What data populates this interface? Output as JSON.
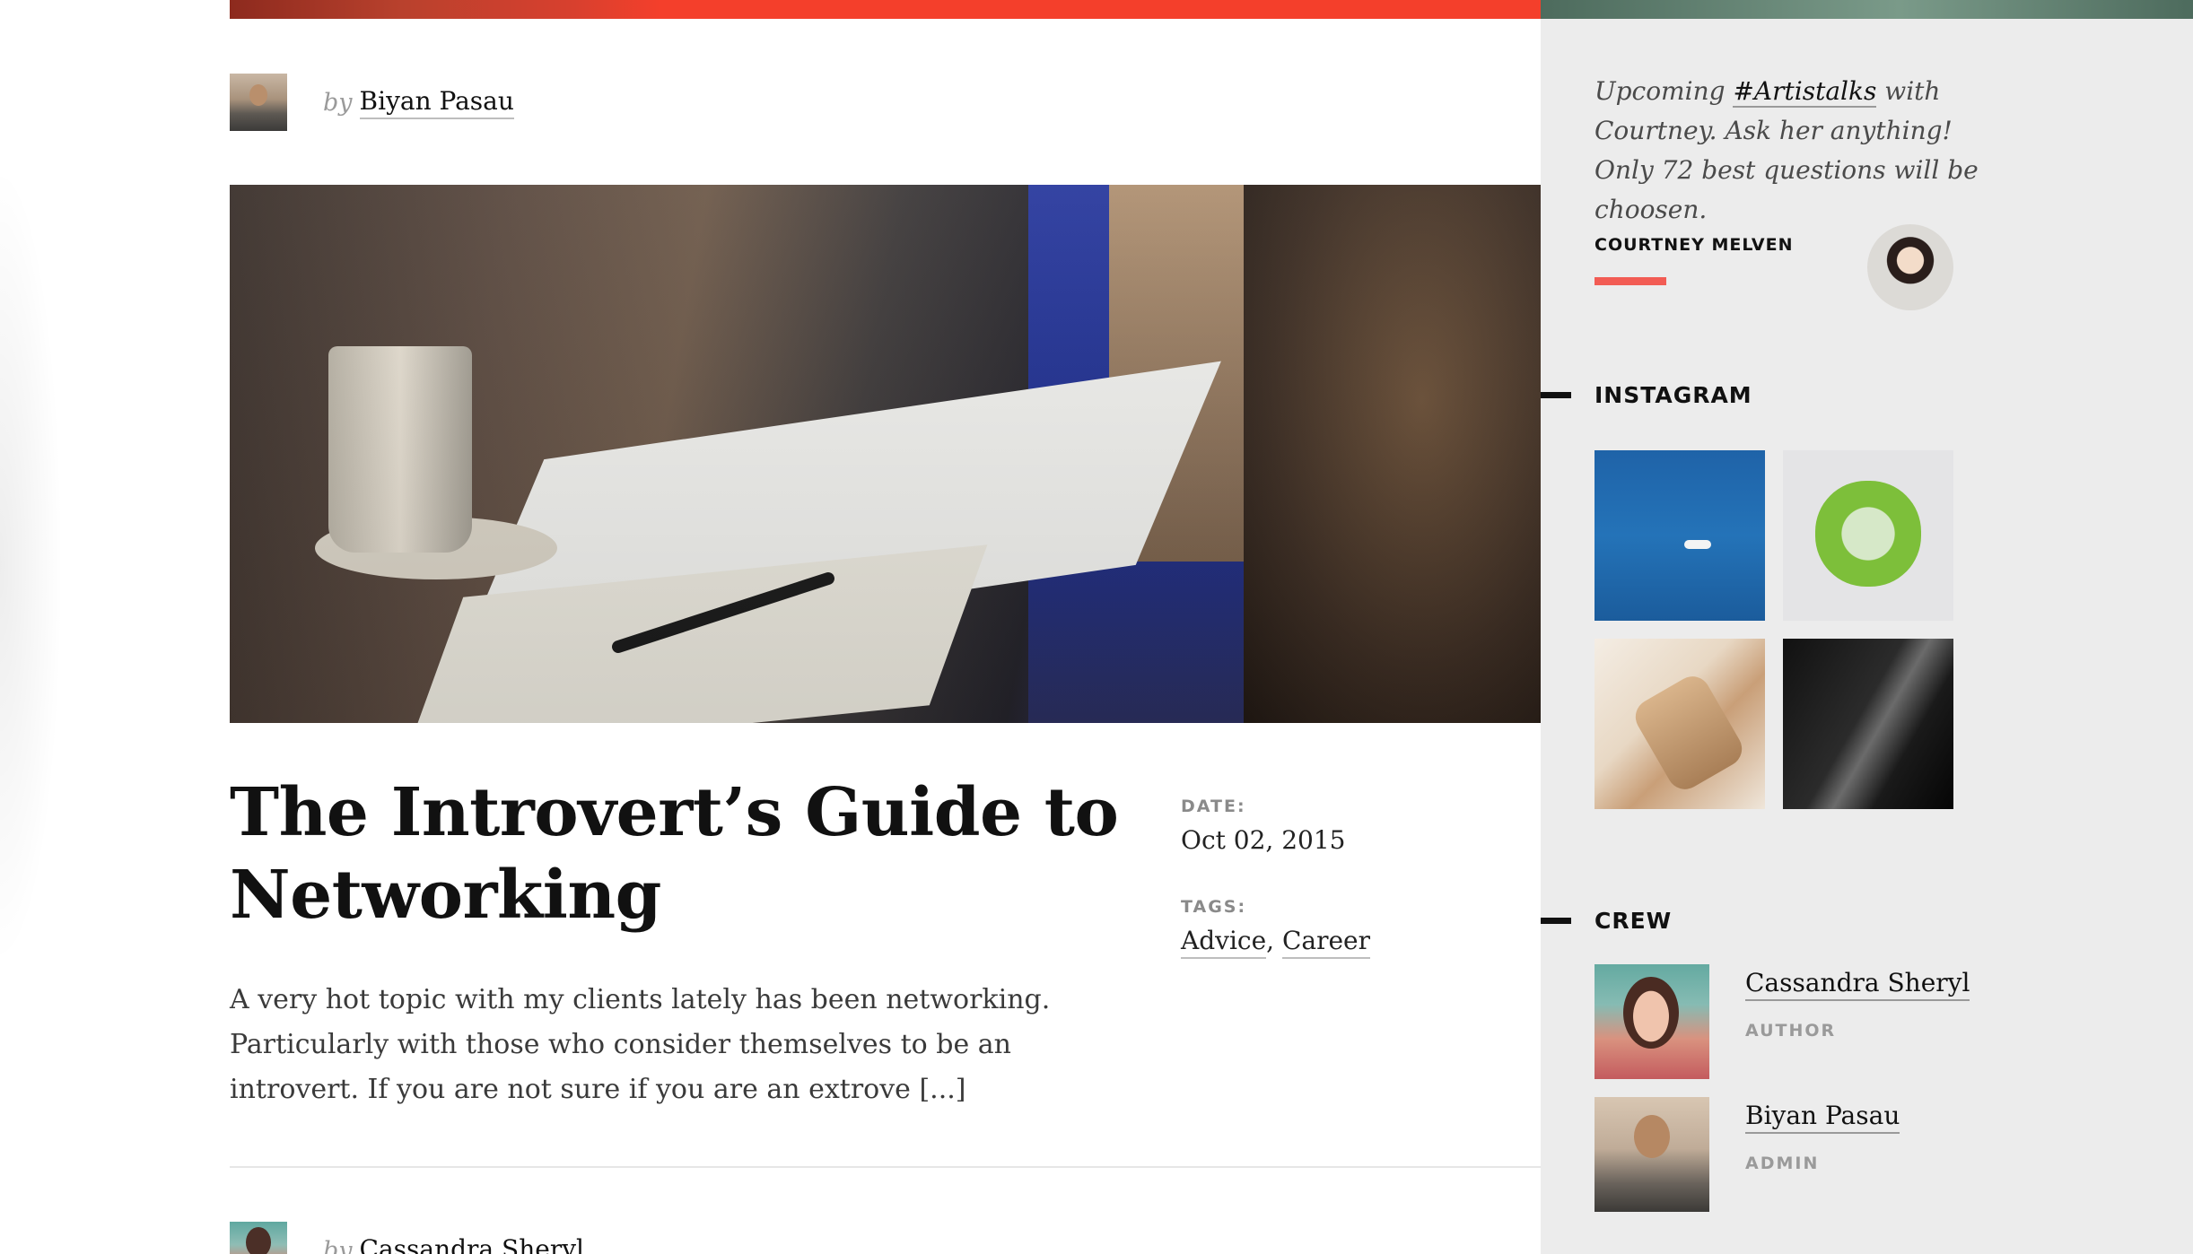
{
  "featured_post": {
    "author_prefix": "by",
    "author": "Biyan Pasau",
    "title": "The Introvert’s Guide to Networking",
    "excerpt": "A very hot topic with my clients lately has been networking. Particularly with those who consider themselves to be an introvert. If you are not sure if you are an extrove [...]",
    "date_label": "DATE:",
    "date": "Oct 02, 2015",
    "tags_label": "TAGS:",
    "tags": [
      "Advice",
      "Career"
    ],
    "tag_separator": ","
  },
  "next_post": {
    "author_prefix": "by",
    "author": "Cassandra Sheryl"
  },
  "sidebar": {
    "quote": {
      "before": "Upcoming ",
      "hashtag": "#Artistalks",
      "after": " with Courtney. Ask her anything! Only 72 best questions will be choosen.",
      "author": "COURTNEY MELVEN",
      "accent_color": "#f25c54"
    },
    "instagram": {
      "title": "INSTAGRAM",
      "photos": [
        "sea-boat",
        "green-bowl",
        "bottle",
        "bw-architecture"
      ]
    },
    "crew": {
      "title": "CREW",
      "members": [
        {
          "name": "Cassandra Sheryl",
          "role": "AUTHOR"
        },
        {
          "name": "Biyan Pasau",
          "role": "ADMIN"
        }
      ]
    }
  },
  "colors": {
    "accent": "#f43f2b",
    "sidebar_bg": "#ececec",
    "text": "#111111"
  }
}
